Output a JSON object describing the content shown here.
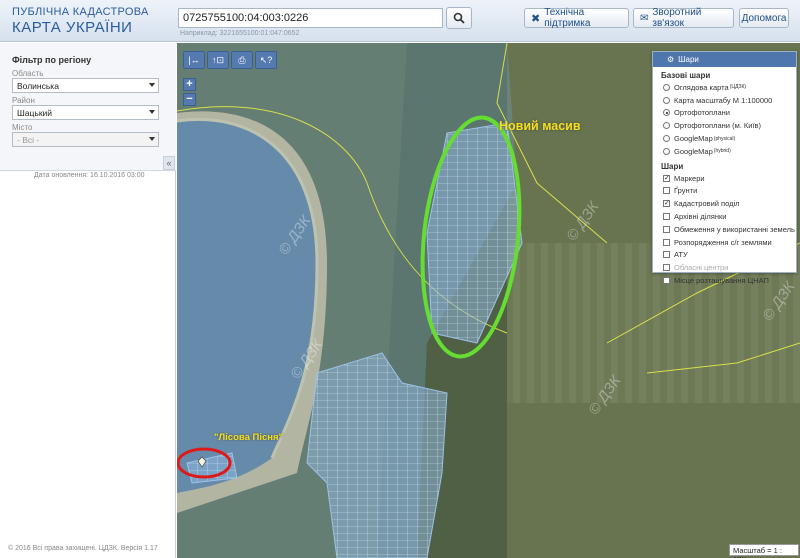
{
  "header": {
    "logo_line1": "ПУБЛІЧНА КАДАСТРОВА",
    "logo_line2": "КАРТА УКРАЇНИ",
    "search_value": "0725755100:04:003:0226",
    "search_hint": "Наприклад: 3221655100:01:047:0652",
    "btn_support": "Технічна підтримка",
    "btn_feedback": "Зворотний зв'язок",
    "btn_help": "Допомога"
  },
  "filter": {
    "title": "Фільтр по регіону",
    "oblast_label": "Область",
    "oblast_value": "Волинська",
    "raion_label": "Район",
    "raion_value": "Шацький",
    "misto_label": "Місто",
    "misto_value": "- Всі -",
    "updated": "Дата оновлення: 16.10.2016 03:00",
    "copyright": "© 2016 Всі права захищені. ЦДЗК. Версія 1.17"
  },
  "map": {
    "label_new": "Новий масив",
    "label_lisova": "\"Лісова Пісня\"",
    "watermark": "© ДЗК",
    "scale": "Масштаб = 1 : 17K",
    "colors": {
      "accent_green": "#66dd33",
      "accent_red": "#dd1a1a",
      "label_yellow": "#f4e01e",
      "parcel_fill": "#7aaee0"
    }
  },
  "layers": {
    "title": "Шари",
    "base_title": "Базові шари",
    "base": [
      {
        "label": "Оглядова карта",
        "sup": "(ЦДЗК)",
        "on": false
      },
      {
        "label": "Карта масштабу М 1:100000",
        "sup": "",
        "on": false
      },
      {
        "label": "Ортофотоплани",
        "sup": "",
        "on": true
      },
      {
        "label": "Ортофотоплани (м. Київ)",
        "sup": "",
        "on": false
      },
      {
        "label": "GoogleMap",
        "sup": "(physical)",
        "on": false
      },
      {
        "label": "GoogleMap",
        "sup": "(hybrid)",
        "on": false
      }
    ],
    "overlay_title": "Шари",
    "overlay": [
      {
        "label": "Маркери",
        "checked": true,
        "disabled": false
      },
      {
        "label": "Ґрунти",
        "checked": false,
        "disabled": false
      },
      {
        "label": "Кадастровий поділ",
        "checked": true,
        "disabled": false
      },
      {
        "label": "Архівні ділянки",
        "checked": false,
        "disabled": false
      },
      {
        "label": "Обмеження у використанні земель",
        "checked": false,
        "disabled": false
      },
      {
        "label": "Розпорядження с/г землями",
        "checked": false,
        "disabled": false
      },
      {
        "label": "АТУ",
        "checked": false,
        "disabled": false
      },
      {
        "label": "Обласні центри",
        "checked": false,
        "disabled": true
      },
      {
        "label": "Місце розташування ЦНАП",
        "checked": false,
        "disabled": false
      }
    ]
  }
}
